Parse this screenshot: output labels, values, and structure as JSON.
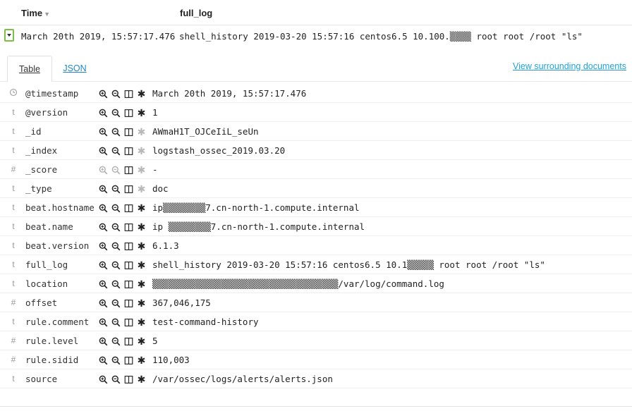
{
  "header": {
    "time_label": "Time",
    "sort_icon": "sort-down-icon",
    "full_log_label": "full_log"
  },
  "doc": {
    "time": "March 20th 2019, 15:57:17.476",
    "full_log": "shell_history 2019-03-20 15:57:16 centos6.5 10.100.▒▒▒▒ root root /root \"ls\""
  },
  "tabs": {
    "table": "Table",
    "json": "JSON",
    "surrounding": "View surrounding documents"
  },
  "fields": [
    {
      "type": "clock",
      "name": "@timestamp",
      "value": "March 20th 2019, 15:57:17.476",
      "filter": true,
      "exists": true
    },
    {
      "type": "t",
      "name": "@version",
      "value": "1",
      "filter": true,
      "exists": true
    },
    {
      "type": "t",
      "name": "_id",
      "value": "AWmaH1T_OJCeIiL_seUn",
      "filter": true,
      "exists": false
    },
    {
      "type": "t",
      "name": "_index",
      "value": "logstash_ossec_2019.03.20",
      "filter": true,
      "exists": false
    },
    {
      "type": "#",
      "name": "_score",
      "value": " -",
      "filter": false,
      "exists": false
    },
    {
      "type": "t",
      "name": "_type",
      "value": "doc",
      "filter": true,
      "exists": false
    },
    {
      "type": "t",
      "name": "beat.hostname",
      "value": "ip▒▒▒▒▒▒▒▒7.cn-north-1.compute.internal",
      "filter": true,
      "exists": true
    },
    {
      "type": "t",
      "name": "beat.name",
      "value": "ip ▒▒▒▒▒▒▒▒7.cn-north-1.compute.internal",
      "filter": true,
      "exists": true
    },
    {
      "type": "t",
      "name": "beat.version",
      "value": "6.1.3",
      "filter": true,
      "exists": true
    },
    {
      "type": "t",
      "name": "full_log",
      "value": "shell_history 2019-03-20 15:57:16 centos6.5 10.1▒▒▒▒▒ root root /root \"ls\"",
      "filter": true,
      "exists": true
    },
    {
      "type": "t",
      "name": "location",
      "value": "▒▒▒▒▒▒▒▒▒▒▒▒▒▒▒▒▒▒▒▒▒▒▒▒▒▒▒▒▒▒▒▒▒▒▒/var/log/command.log",
      "filter": true,
      "exists": true
    },
    {
      "type": "#",
      "name": "offset",
      "value": "367,046,175",
      "filter": true,
      "exists": true
    },
    {
      "type": "t",
      "name": "rule.comment",
      "value": "test-command-history",
      "filter": true,
      "exists": true
    },
    {
      "type": "#",
      "name": "rule.level",
      "value": "5",
      "filter": true,
      "exists": true
    },
    {
      "type": "#",
      "name": "rule.sidid",
      "value": "110,003",
      "filter": true,
      "exists": true
    },
    {
      "type": "t",
      "name": "source",
      "value": "/var/ossec/logs/alerts/alerts.json",
      "filter": true,
      "exists": true
    }
  ],
  "icons": {
    "filter_for": "magnify-plus-icon",
    "filter_out": "magnify-minus-icon",
    "toggle_column": "table-column-icon",
    "filter_exists": "asterisk-icon"
  },
  "colors": {
    "expander_border": "#7ac143",
    "link": "#1ea2e0"
  }
}
